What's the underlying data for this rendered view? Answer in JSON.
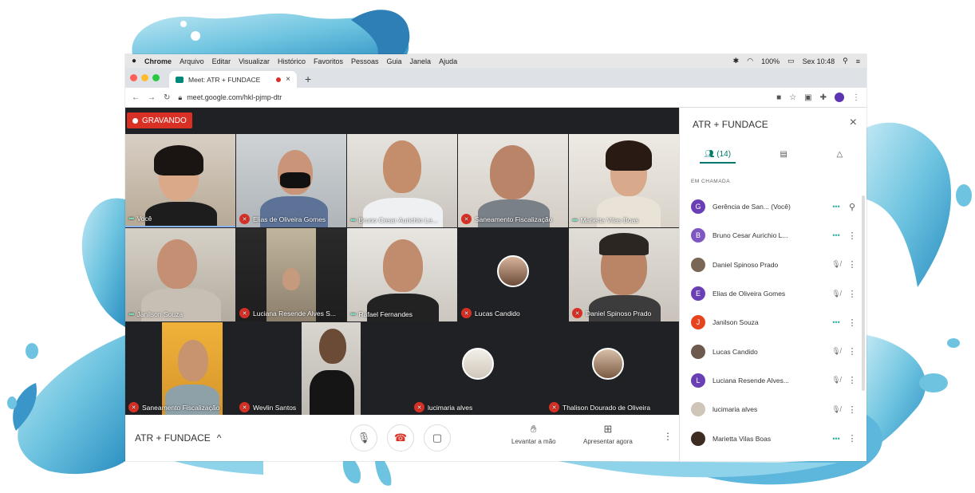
{
  "menubar": {
    "apple": "",
    "items": [
      "Chrome",
      "Arquivo",
      "Editar",
      "Visualizar",
      "Histórico",
      "Favoritos",
      "Pessoas",
      "Guia",
      "Janela",
      "Ajuda"
    ],
    "battery": "100%",
    "clock": "Sex 10:48"
  },
  "browser": {
    "tab_title": "Meet: ATR + FUNDACE",
    "url": "meet.google.com/hkl-pjmp-dtr"
  },
  "meet": {
    "recording_label": "GRAVANDO",
    "tiles": [
      {
        "name": "Você",
        "muted": false
      },
      {
        "name": "Elias de Oliveira Gomes",
        "muted": true
      },
      {
        "name": "Bruno Cesar Aurichio Le...",
        "muted": false
      },
      {
        "name": "Saneamento Fiscalização",
        "muted": true
      },
      {
        "name": "Marietta Vilas Boas",
        "muted": false
      },
      {
        "name": "Janilson Souza",
        "muted": false
      },
      {
        "name": "Luciana Resende Alves S...",
        "muted": true
      },
      {
        "name": "Rafael Fernandes",
        "muted": false
      },
      {
        "name": "Lucas Candido",
        "muted": true
      },
      {
        "name": "Daniel Spinoso Prado",
        "muted": true
      },
      {
        "name": "Saneamento Fiscalização",
        "muted": true
      },
      {
        "name": "Wevlin Santos",
        "muted": true
      },
      {
        "name": "lucimaria alves",
        "muted": true
      },
      {
        "name": "Thalison Dourado de Oliveira",
        "muted": true
      }
    ],
    "meeting_name": "ATR + FUNDACE",
    "raise_hand_label": "Levantar a mão",
    "present_label": "Apresentar agora"
  },
  "sidebar": {
    "title": "ATR + FUNDACE",
    "people_count": "(14)",
    "section_label": "EM CHAMADA",
    "participants": [
      {
        "initial": "G",
        "name": "Gerência de San...  (Você)",
        "color": "#6a3fb5",
        "status": "speaking"
      },
      {
        "initial": "B",
        "name": "Bruno Cesar Aurichio L...",
        "color": "#7e57c2",
        "status": "speaking"
      },
      {
        "initial": "",
        "name": "Daniel Spinoso Prado",
        "color": "#7a6655",
        "status": "muted"
      },
      {
        "initial": "E",
        "name": "Elias de Oliveira Gomes",
        "color": "#6a3fb5",
        "status": "muted"
      },
      {
        "initial": "J",
        "name": "Janilson Souza",
        "color": "#e8431f",
        "status": "speaking"
      },
      {
        "initial": "",
        "name": "Lucas Candido",
        "color": "#6d5a4c",
        "status": "muted"
      },
      {
        "initial": "L",
        "name": "Luciana Resende Alves...",
        "color": "#6a3fb5",
        "status": "muted"
      },
      {
        "initial": "",
        "name": "lucimaria alves",
        "color": "#cfc5b8",
        "status": "muted"
      },
      {
        "initial": "",
        "name": "Marietta Vilas Boas",
        "color": "#3d2c22",
        "status": "speaking"
      }
    ]
  },
  "colors": {
    "accent": "#00796b",
    "record_red": "#d93025",
    "splash_blue": "#6ec4e0"
  }
}
